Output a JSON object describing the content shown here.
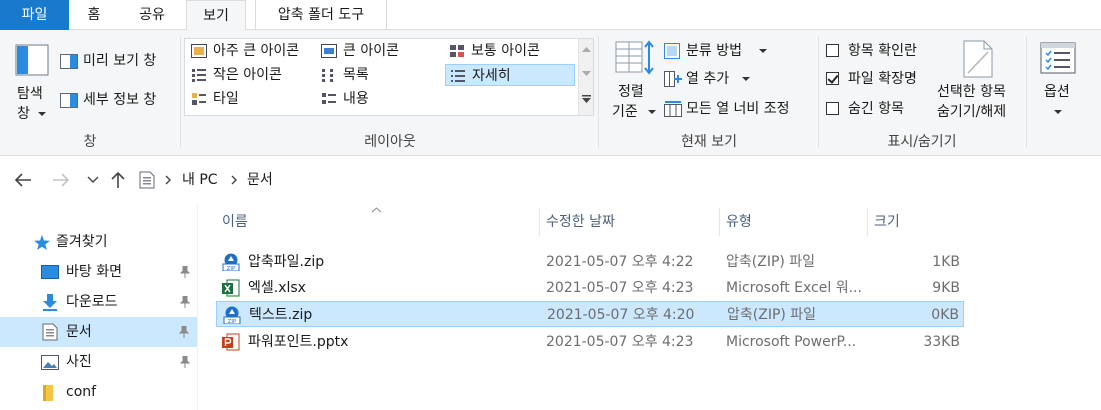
{
  "tabs": {
    "file": "파일",
    "home": "홈",
    "share": "공유",
    "view": "보기",
    "compressed_tools": "압축 폴더 도구"
  },
  "ribbon": {
    "pane_group": {
      "nav_pane_line1": "탐색",
      "nav_pane_line2": "창",
      "preview_pane": "미리 보기 창",
      "details_pane": "세부 정보 창",
      "label": "창"
    },
    "layout_group": {
      "items": [
        "아주 큰 아이콘",
        "큰 아이콘",
        "보통 아이콘",
        "작은 아이콘",
        "목록",
        "자세히",
        "타일",
        "내용"
      ],
      "label": "레이아웃"
    },
    "current_view_group": {
      "sort_line1": "정렬",
      "sort_line2": "기준",
      "group_by": "분류 방법",
      "add_columns": "열 추가",
      "size_columns": "모든 열 너비 조정",
      "label": "현재 보기"
    },
    "show_hide_group": {
      "item_checkboxes": "항목 확인란",
      "file_extensions": "파일 확장명",
      "hidden_items": "숨긴 항목",
      "hide_selected_line1": "선택한 항목",
      "hide_selected_line2": "숨기기/해제",
      "label": "표시/숨기기"
    },
    "options": "옵션"
  },
  "address": {
    "this_pc": "내 PC",
    "folder": "문서"
  },
  "nav": {
    "quick_access": "즐겨찾기",
    "desktop": "바탕 화면",
    "downloads": "다운로드",
    "documents": "문서",
    "pictures": "사진",
    "conf": "conf"
  },
  "columns": {
    "name": "이름",
    "modified": "수정한 날짜",
    "type": "유형",
    "size": "크기"
  },
  "files": [
    {
      "name": "압축파일.zip",
      "modified": "2021-05-07 오후 4:22",
      "type": "압축(ZIP) 파일",
      "size": "1KB"
    },
    {
      "name": "엑셀.xlsx",
      "modified": "2021-05-07 오후 4:23",
      "type": "Microsoft Excel 워...",
      "size": "9KB"
    },
    {
      "name": "텍스트.zip",
      "modified": "2021-05-07 오후 4:20",
      "type": "압축(ZIP) 파일",
      "size": "0KB"
    },
    {
      "name": "파워포인트.pptx",
      "modified": "2021-05-07 오후 4:23",
      "type": "Microsoft PowerP...",
      "size": "33KB"
    }
  ],
  "colors": {
    "accent": "#1979ca",
    "selection": "#cce8ff",
    "selection_border": "#99d1ff"
  }
}
